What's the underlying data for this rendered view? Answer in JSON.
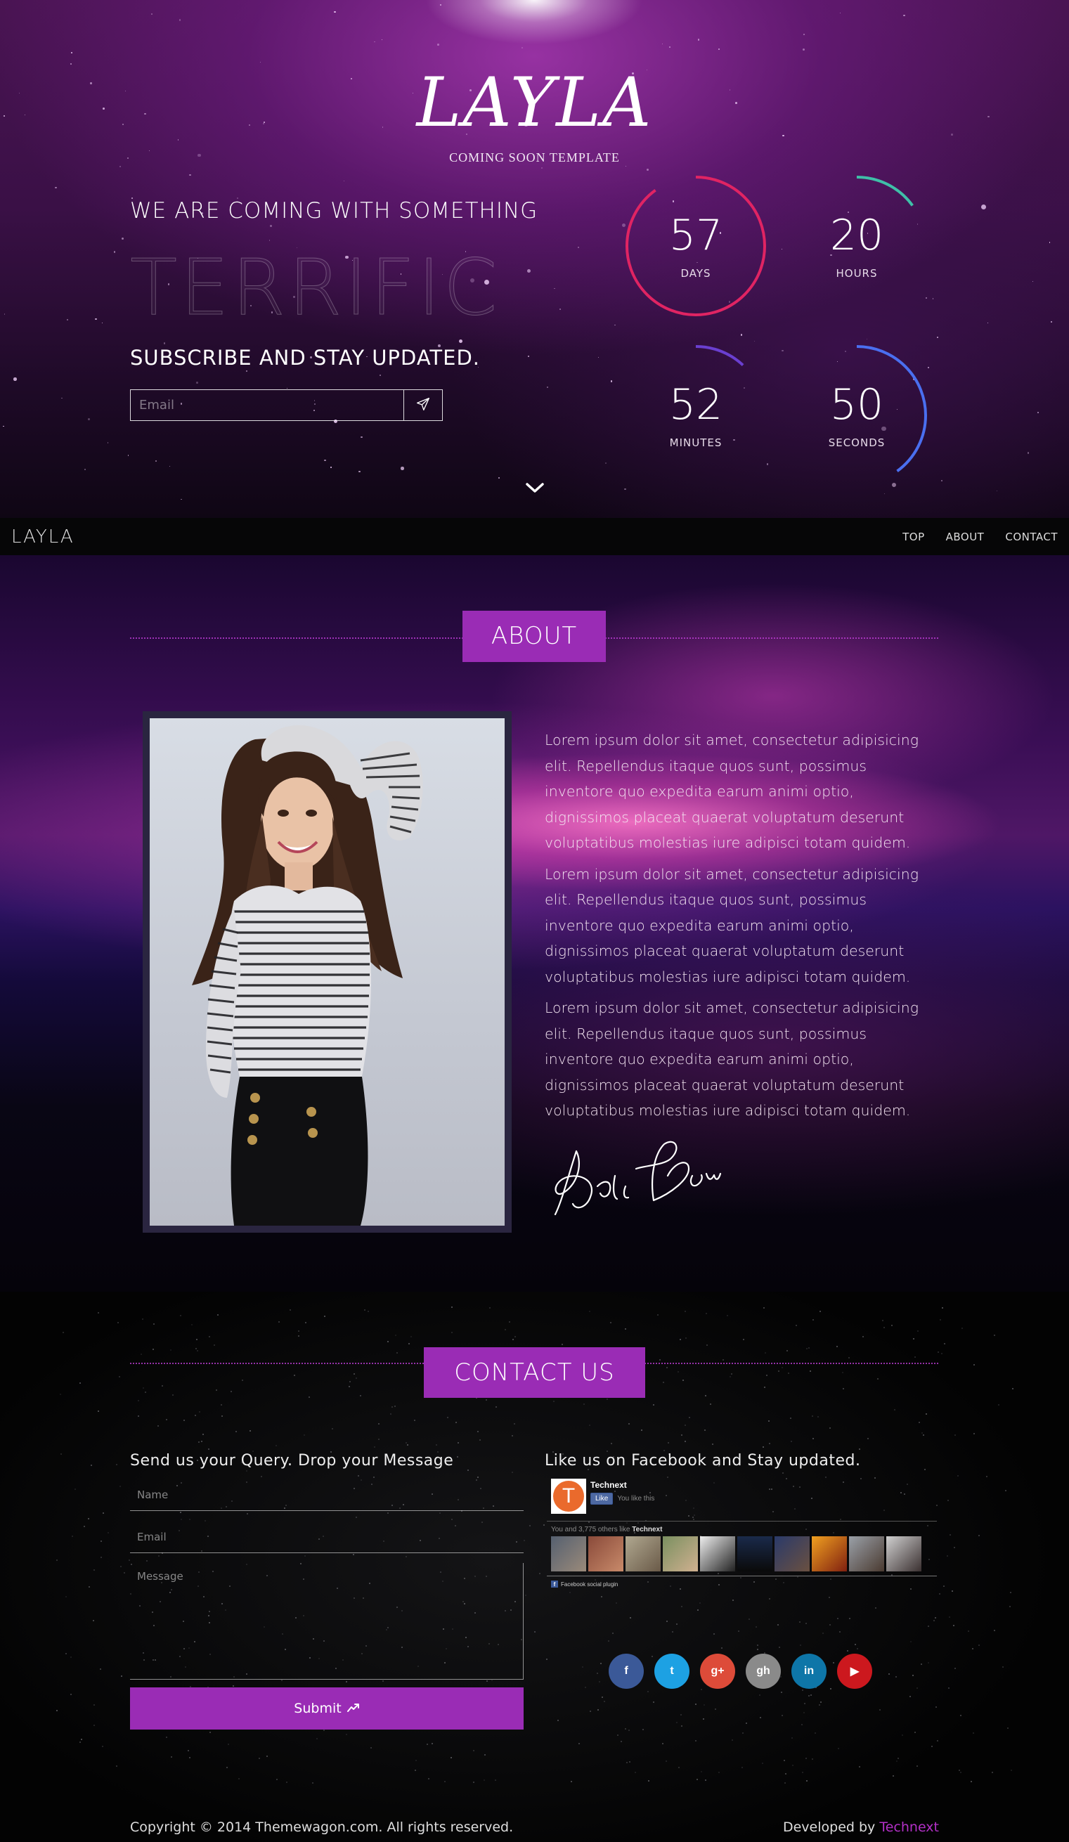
{
  "hero": {
    "brand": "LAYLA",
    "tagline": "COMING SOON TEMPLATE",
    "headline": "WE ARE COMING WITH SOMETHING",
    "big_word": "TERRIFIC",
    "subscribe_heading": "SUBSCRIBE AND STAY UPDATED.",
    "email_placeholder": "Email",
    "send_icon": "paper-plane-icon",
    "scroll_icon": "chevron-down-icon",
    "countdown": [
      {
        "value": "57",
        "label": "DAYS",
        "color": "#e02463",
        "progress": 0.9
      },
      {
        "value": "20",
        "label": "HOURS",
        "color": "#3fbfa8",
        "progress": 0.15
      },
      {
        "value": "52",
        "label": "MINUTES",
        "color": "#6a3fd0",
        "progress": 0.12
      },
      {
        "value": "50",
        "label": "SECONDS",
        "color": "#4a6ff0",
        "progress": 0.4
      }
    ]
  },
  "nav": {
    "brand": "LAYLA",
    "links": [
      "TOP",
      "ABOUT",
      "CONTACT"
    ]
  },
  "about": {
    "title": "ABOUT",
    "paragraphs": [
      "Lorem ipsum dolor sit amet, consectetur adipisicing elit. Repellendus itaque quos sunt, possimus inventore quo expedita earum animi optio, dignissimos placeat quaerat voluptatum deserunt voluptatibus molestias iure adipisci totam quidem.",
      "Lorem ipsum dolor sit amet, consectetur adipisicing elit. Repellendus itaque quos sunt, possimus inventore quo expedita earum animi optio, dignissimos placeat quaerat voluptatum deserunt voluptatibus molestias iure adipisci totam quidem.",
      "Lorem ipsum dolor sit amet, consectetur adipisicing elit. Repellendus itaque quos sunt, possimus inventore quo expedita earum animi optio, dignissimos placeat quaerat voluptatum deserunt voluptatibus molestias iure adipisci totam quidem."
    ],
    "signature": "John Doe"
  },
  "contact": {
    "title": "CONTACT US",
    "form_heading": "Send us your Query. Drop your Message",
    "name_placeholder": "Name",
    "email_placeholder": "Email",
    "message_placeholder": "Message",
    "submit_label": "Submit",
    "facebook_heading": "Like us on Facebook and Stay updated.",
    "facebook": {
      "page_initial": "T",
      "page_name": "Technext",
      "like_label": "Like",
      "like_note": "You like this",
      "likes_prefix": "You and 3,775 others like",
      "likes_page": "Technext",
      "plugin_label": "Facebook social plugin"
    },
    "socials": [
      {
        "name": "facebook-icon",
        "glyph": "f",
        "color": "#3b5998"
      },
      {
        "name": "twitter-icon",
        "glyph": "t",
        "color": "#1da1e3"
      },
      {
        "name": "google-plus-icon",
        "glyph": "g+",
        "color": "#dd4b39"
      },
      {
        "name": "github-icon",
        "glyph": "gh",
        "color": "#8a8a8a"
      },
      {
        "name": "linkedin-icon",
        "glyph": "in",
        "color": "#0e76a8"
      },
      {
        "name": "youtube-icon",
        "glyph": "▶",
        "color": "#cc181e"
      }
    ]
  },
  "footer": {
    "copyright": "Copyright © 2014 Themewagon.com. All rights reserved.",
    "developed_prefix": "Developed by",
    "developed_link": "Technext"
  },
  "colors": {
    "accent": "#9a2cb5",
    "link": "#b230c6"
  }
}
